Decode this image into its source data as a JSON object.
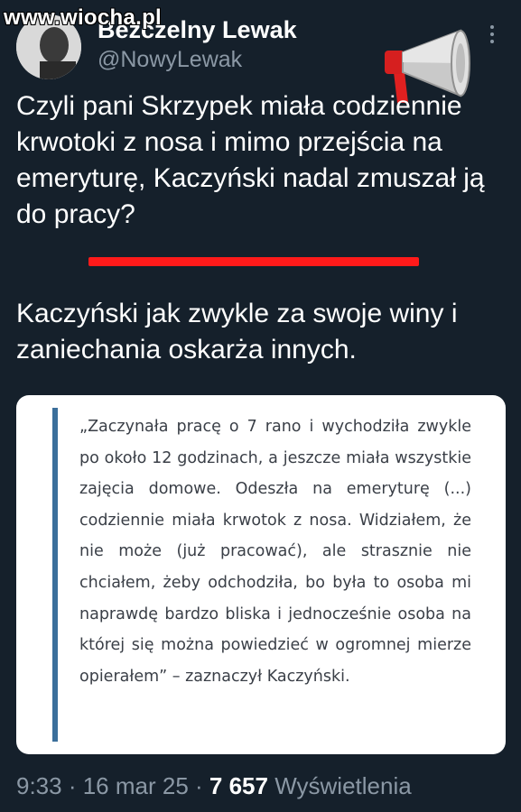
{
  "watermark": "www.wiocha.pl",
  "author": {
    "display_name": "Bezczelny Lewak",
    "handle": "@NowyLewak"
  },
  "tweet": {
    "paragraph1": "Czyli pani Skrzypek miała codziennie krwotoki z nosa i mimo przejścia na emeryturę, Kaczyński nadal zmuszał ją do pracy?",
    "paragraph2": "Kaczyński jak zwykle za swoje winy i zaniechania oskarża innych."
  },
  "quote_image": {
    "text": "„Zaczynała pracę o 7 rano i wychodziła zwykle po około 12 godzinach, a jeszcze miała wszystkie zajęcia domowe. Odeszła na emeryturę (...) codziennie miała krwotok z nosa. Widziałem, że nie może (już pracować), ale strasznie nie chciałem, żeby odchodziła, bo była to osoba mi naprawdę bardzo bliska i jednocześnie osoba na której się można powiedzieć w ogromnej mierze opierałem” – zaznaczył Kaczyński."
  },
  "meta": {
    "time": "9:33",
    "sep1": " · ",
    "date": "16 mar 25",
    "sep2": " · ",
    "views_count": "7 657",
    "views_label": " Wyświetlenia"
  },
  "icons": {
    "more": "more-vertical-icon",
    "megaphone": "megaphone-icon"
  },
  "colors": {
    "background": "#15202b",
    "secondary_text": "#8b98a5",
    "underline": "#ff1a1a",
    "quote_bar": "#3b6f9b"
  }
}
